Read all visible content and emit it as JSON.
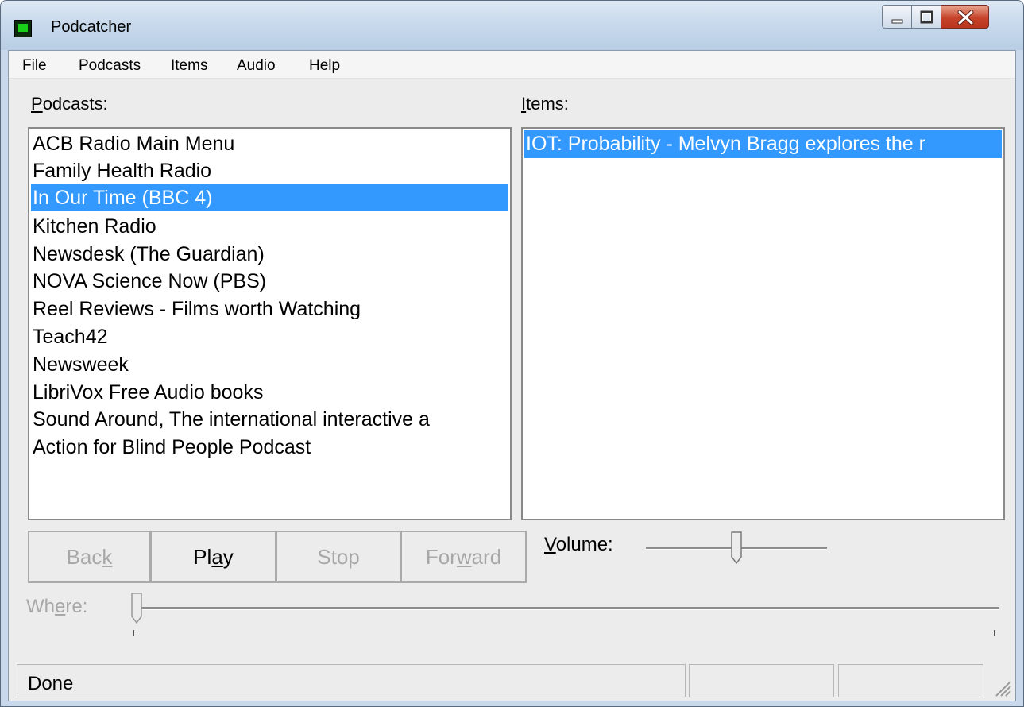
{
  "window": {
    "title": "Podcatcher"
  },
  "menu": [
    {
      "label": "File"
    },
    {
      "label": "Podcasts"
    },
    {
      "label": "Items"
    },
    {
      "label": "Audio"
    },
    {
      "label": "Help"
    }
  ],
  "podcasts": {
    "label_mnemonic": "P",
    "label_rest": "odcasts:",
    "items": [
      {
        "label": "ACB Radio Main Menu"
      },
      {
        "label": "Family Health Radio"
      },
      {
        "label": "In Our Time (BBC 4)",
        "selected": true
      },
      {
        "label": "Kitchen Radio"
      },
      {
        "label": "Newsdesk (The Guardian)"
      },
      {
        "label": "NOVA Science Now (PBS)"
      },
      {
        "label": "Reel Reviews - Films worth Watching"
      },
      {
        "label": "Teach42"
      },
      {
        "label": "Newsweek"
      },
      {
        "label": "LibriVox Free Audio books"
      },
      {
        "label": "Sound Around, The international interactive a"
      },
      {
        "label": "Action for Blind People Podcast"
      }
    ]
  },
  "items": {
    "label_mnemonic": "I",
    "label_rest": "tems:",
    "items": [
      {
        "label": "IOT: Probability - Melvyn Bragg explores the r",
        "selected": true
      }
    ]
  },
  "controls": {
    "back": {
      "pre": "Bac",
      "mnemonic": "k",
      "post": "",
      "enabled": false
    },
    "play": {
      "pre": "Pl",
      "mnemonic": "a",
      "post": "y",
      "enabled": true
    },
    "stop": {
      "pre": "Stop",
      "mnemonic": "",
      "post": "",
      "enabled": false
    },
    "forward": {
      "pre": "For",
      "mnemonic": "w",
      "post": "ard",
      "enabled": false
    }
  },
  "volume": {
    "label_mnemonic": "V",
    "label_rest": "olume:",
    "level": 0.5
  },
  "where": {
    "label_pre": "Wh",
    "label_mnemonic": "e",
    "label_post": "re:",
    "position": 0.0,
    "enabled": false
  },
  "status": {
    "text": "Done"
  },
  "colors": {
    "selection": "#3399ff",
    "titlebar": "#c9daec",
    "client": "#ececec"
  },
  "icons": {
    "app": "podcatcher-app-icon",
    "minimize": "minimize-icon",
    "maximize": "maximize-icon",
    "close": "close-icon",
    "grip": "resize-grip-icon"
  }
}
